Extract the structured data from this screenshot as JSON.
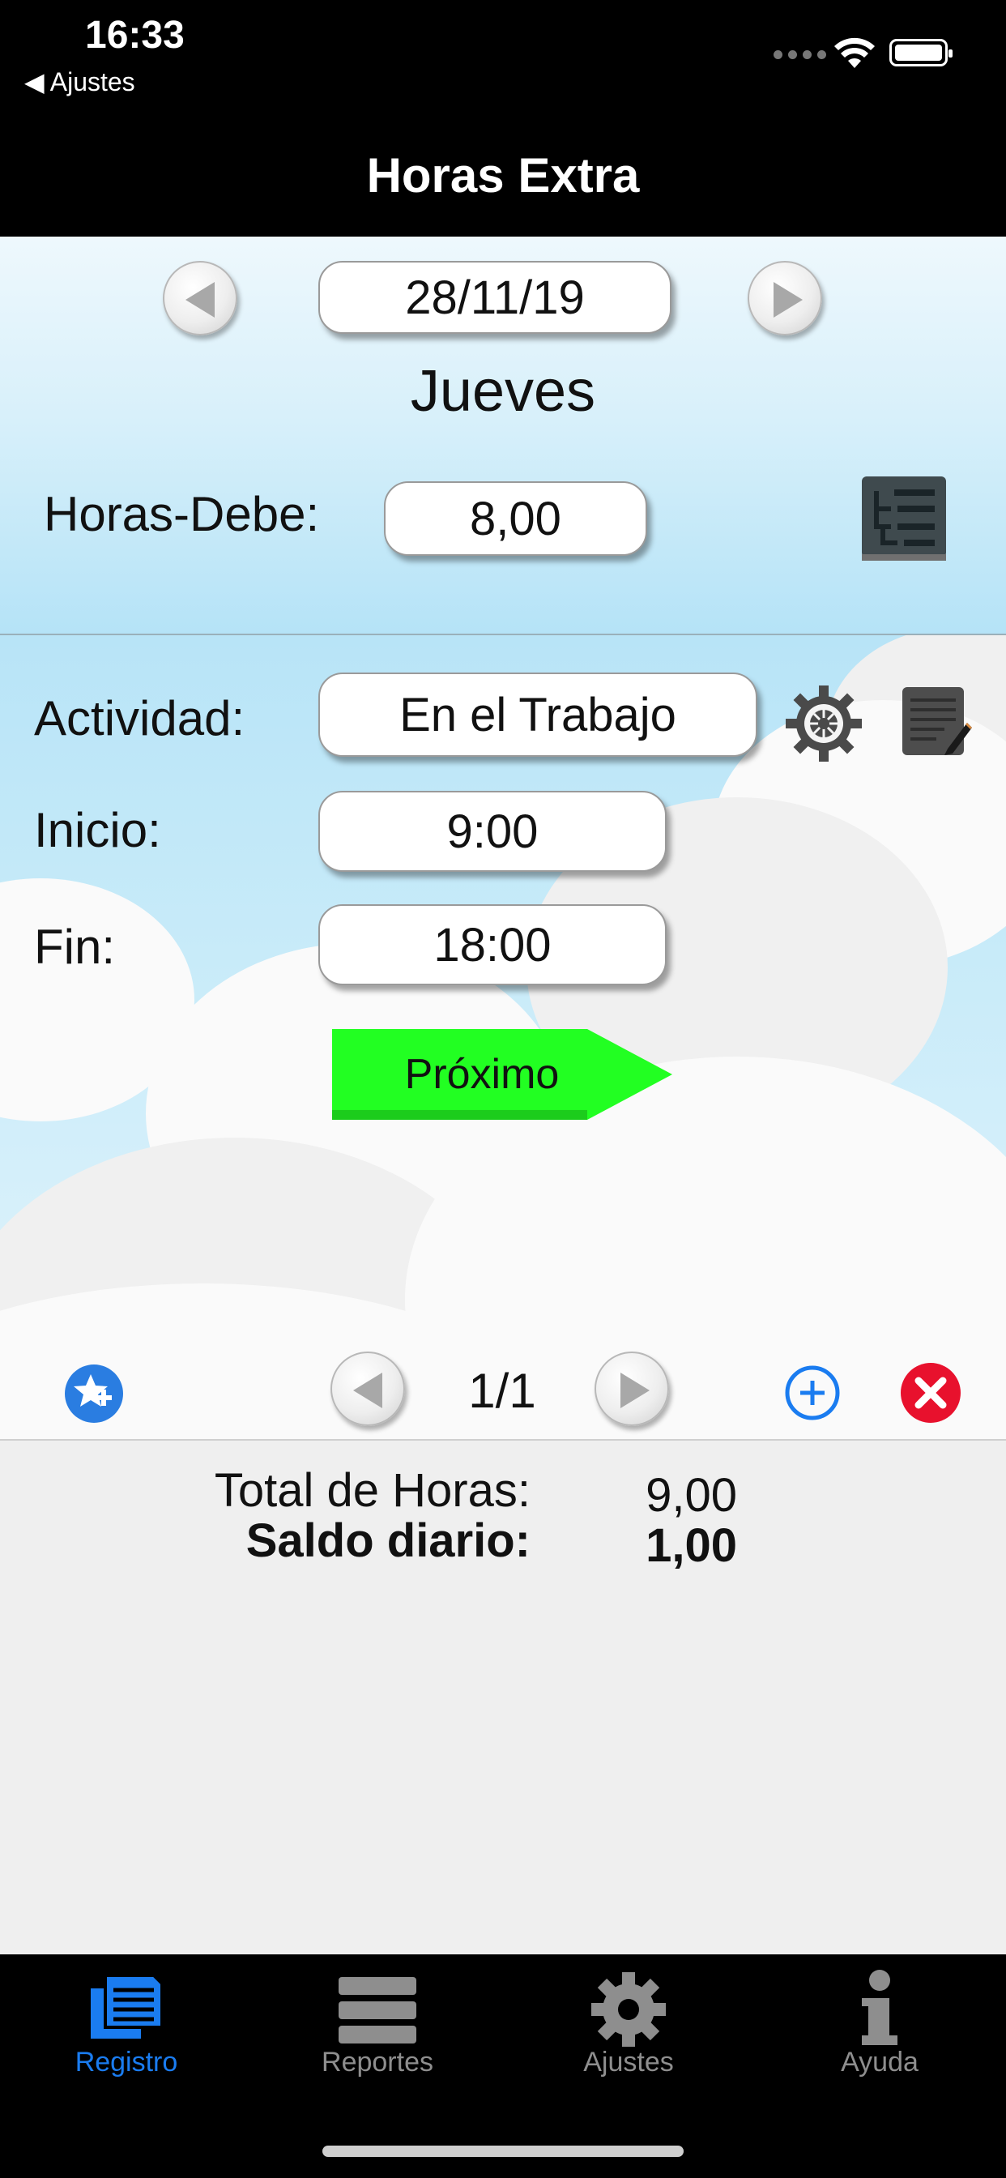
{
  "status_bar": {
    "time": "16:33",
    "back_label": "◀ Ajustes"
  },
  "nav": {
    "title": "Horas Extra"
  },
  "date_panel": {
    "date": "28/11/19",
    "weekday": "Jueves",
    "hours_due_label": "Horas-Debe:",
    "hours_due_value": "8,00"
  },
  "entry": {
    "activity_label": "Actividad:",
    "activity_value": "En el Trabajo",
    "start_label": "Inicio:",
    "start_value": "9:00",
    "end_label": "Fin:",
    "end_value": "18:00",
    "next_button": "Próximo"
  },
  "pager": {
    "page_indicator": "1/1"
  },
  "totals": {
    "total_label": "Total de Horas:",
    "total_value": "9,00",
    "balance_label": "Saldo diario:",
    "balance_value": "1,00"
  },
  "tabs": [
    {
      "label": "Registro",
      "icon": "registro-icon",
      "active": true
    },
    {
      "label": "Reportes",
      "icon": "list-icon",
      "active": false
    },
    {
      "label": "Ajustes",
      "icon": "gear-icon",
      "active": false
    },
    {
      "label": "Ayuda",
      "icon": "info-icon",
      "active": false
    }
  ],
  "colors": {
    "accent": "#1a7cf0",
    "next_button": "#22ff22",
    "delete": "#e8112d"
  }
}
